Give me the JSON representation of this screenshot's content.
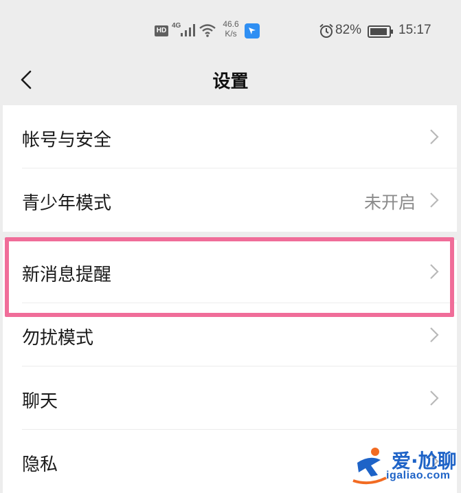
{
  "status_bar": {
    "hd_badge": "HD",
    "network_type": "4G",
    "speed_value": "46.6",
    "speed_unit": "K/s",
    "battery_percent": "82%",
    "time": "15:17",
    "icons": [
      "hd-icon",
      "signal-icon",
      "wifi-icon",
      "app-notification-icon",
      "alarm-icon",
      "battery-icon"
    ]
  },
  "nav": {
    "title": "设置",
    "back_icon": "back-chevron-icon"
  },
  "settings": {
    "items": [
      {
        "label": "帐号与安全",
        "value": ""
      },
      {
        "label": "青少年模式",
        "value": "未开启"
      },
      {
        "label": "新消息提醒",
        "value": ""
      },
      {
        "label": "勿扰模式",
        "value": ""
      },
      {
        "label": "聊天",
        "value": ""
      },
      {
        "label": "隐私",
        "value": ""
      }
    ]
  },
  "highlight": {
    "color": "#f06d99",
    "target": "新消息提醒"
  },
  "watermark": {
    "title": "爱·尬聊",
    "site": "igaliao.com",
    "color": "#1e63c7",
    "accent": "#f26b22"
  }
}
